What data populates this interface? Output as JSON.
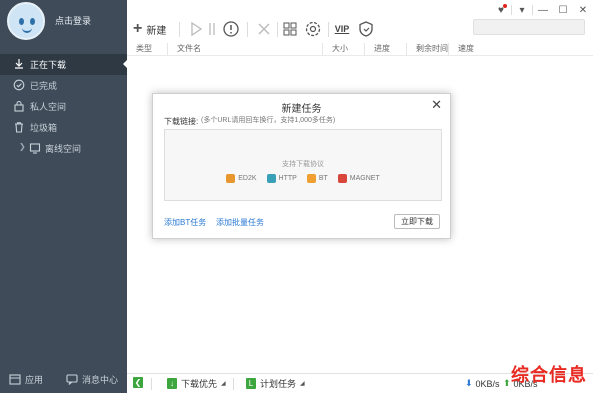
{
  "user": {
    "login_text": "点击登录"
  },
  "sidebar": {
    "items": [
      {
        "label": "正在下载",
        "icon": "download-icon",
        "active": true
      },
      {
        "label": "已完成",
        "icon": "check-circle-icon"
      },
      {
        "label": "私人空间",
        "icon": "lock-icon"
      },
      {
        "label": "垃圾箱",
        "icon": "trash-icon"
      },
      {
        "label": "离线空间",
        "icon": "cloud-icon",
        "expandable": true
      }
    ],
    "bottom": {
      "apps_label": "应用",
      "messages_label": "消息中心"
    }
  },
  "toolbar": {
    "new_label": "新建",
    "vip_label": "VIP"
  },
  "search": {
    "placeholder": ""
  },
  "table": {
    "columns": [
      "类型",
      "文件名",
      "大小",
      "进度",
      "剩余时间",
      "速度"
    ]
  },
  "dialog": {
    "title": "新建任务",
    "link_label": "下载链接:",
    "link_placeholder": "(多个URL请用回车换行，支持1,000多任务)",
    "protocols_title": "支持下载协议",
    "protocols": [
      {
        "name": "ED2K",
        "color": "#e8962e"
      },
      {
        "name": "HTTP",
        "color": "#3aa0b8"
      },
      {
        "name": "BT",
        "color": "#f0a030"
      },
      {
        "name": "MAGNET",
        "color": "#d9463c"
      }
    ],
    "add_bt_label": "添加BT任务",
    "add_batch_label": "添加批量任务",
    "download_now_label": "立即下载"
  },
  "statusbar": {
    "priority_label": "下载优先",
    "schedule_label": "计划任务",
    "down_speed": "0KB/s",
    "up_speed": "0KB/s"
  },
  "watermark": {
    "text": "综合信息"
  },
  "colors": {
    "sidebar_bg": "#3f4b58",
    "accent_blue": "#2a79d4",
    "status_green": "#3ea63e",
    "watermark_red": "#e82a22"
  }
}
